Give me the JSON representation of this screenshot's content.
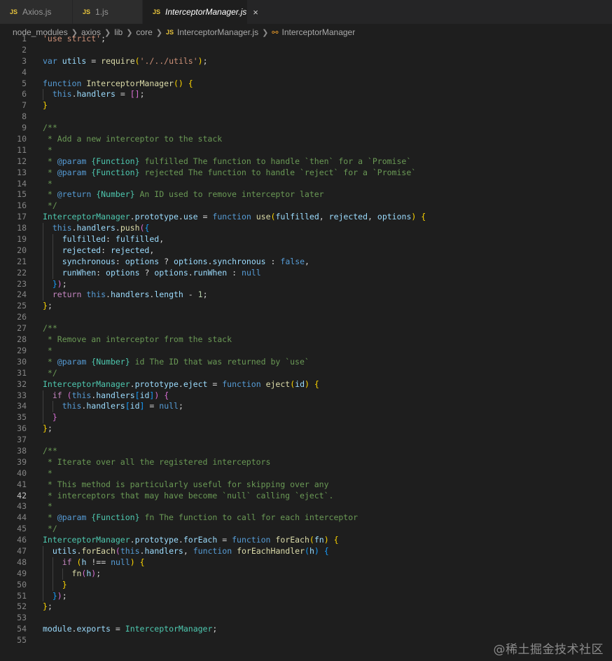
{
  "tabs": [
    {
      "icon": "JS",
      "label": "Axios.js"
    },
    {
      "icon": "JS",
      "label": "1.js"
    },
    {
      "icon": "JS",
      "label": "InterceptorManager.js",
      "close": "×"
    }
  ],
  "breadcrumb": [
    "node_modules",
    "axios",
    "lib",
    "core",
    "InterceptorManager.js",
    "InterceptorManager"
  ],
  "watermark": "@稀土掘金技术社区",
  "current_line": 42,
  "lines": [
    "'use strict';",
    "",
    "var utils = require('./../utils');",
    "",
    "function InterceptorManager() {",
    "  this.handlers = [];",
    "}",
    "",
    "/**",
    " * Add a new interceptor to the stack",
    " *",
    " * @param {Function} fulfilled The function to handle `then` for a `Promise`",
    " * @param {Function} rejected The function to handle `reject` for a `Promise`",
    " *",
    " * @return {Number} An ID used to remove interceptor later",
    " */",
    "InterceptorManager.prototype.use = function use(fulfilled, rejected, options) {",
    "  this.handlers.push({",
    "    fulfilled: fulfilled,",
    "    rejected: rejected,",
    "    synchronous: options ? options.synchronous : false,",
    "    runWhen: options ? options.runWhen : null",
    "  });",
    "  return this.handlers.length - 1;",
    "};",
    "",
    "/**",
    " * Remove an interceptor from the stack",
    " *",
    " * @param {Number} id The ID that was returned by `use`",
    " */",
    "InterceptorManager.prototype.eject = function eject(id) {",
    "  if (this.handlers[id]) {",
    "    this.handlers[id] = null;",
    "  }",
    "};",
    "",
    "/**",
    " * Iterate over all the registered interceptors",
    " *",
    " * This method is particularly useful for skipping over any",
    " * interceptors that may have become `null` calling `eject`.",
    " *",
    " * @param {Function} fn The function to call for each interceptor",
    " */",
    "InterceptorManager.prototype.forEach = function forEach(fn) {",
    "  utils.forEach(this.handlers, function forEachHandler(h) {",
    "    if (h !== null) {",
    "      fn(h);",
    "    }",
    "  });",
    "};",
    "",
    "module.exports = InterceptorManager;",
    ""
  ]
}
